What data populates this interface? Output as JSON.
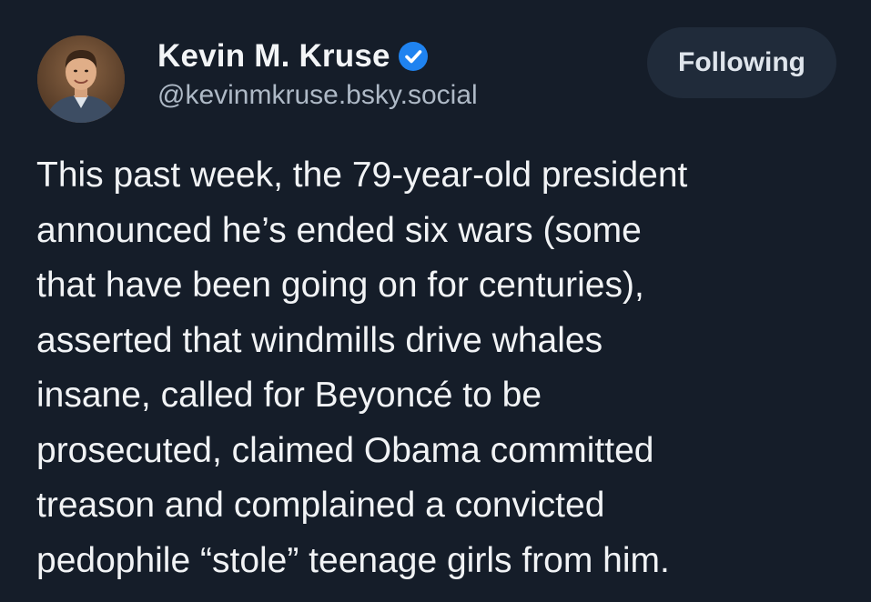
{
  "author": {
    "display_name": "Kevin M. Kruse",
    "handle": "@kevinmkruse.bsky.social",
    "verified_icon": "verified-check-icon",
    "avatar": "author-avatar-photo"
  },
  "follow_button": {
    "label": "Following"
  },
  "post": {
    "lines": [
      "This past week, the 79-year-old president",
      "announced he’s ended six wars (some",
      "that have been going on for centuries),",
      "asserted that windmills drive whales",
      "insane, called for Beyoncé to be",
      "prosecuted, claimed Obama committed",
      "treason and complained a convicted",
      "pedophile “stole” teenage girls from him."
    ]
  },
  "colors": {
    "background": "#151d29",
    "text": "#f1f3f5",
    "handle": "#aeb9c6",
    "button_bg": "#202b3a",
    "verified": "#1f83f0"
  }
}
